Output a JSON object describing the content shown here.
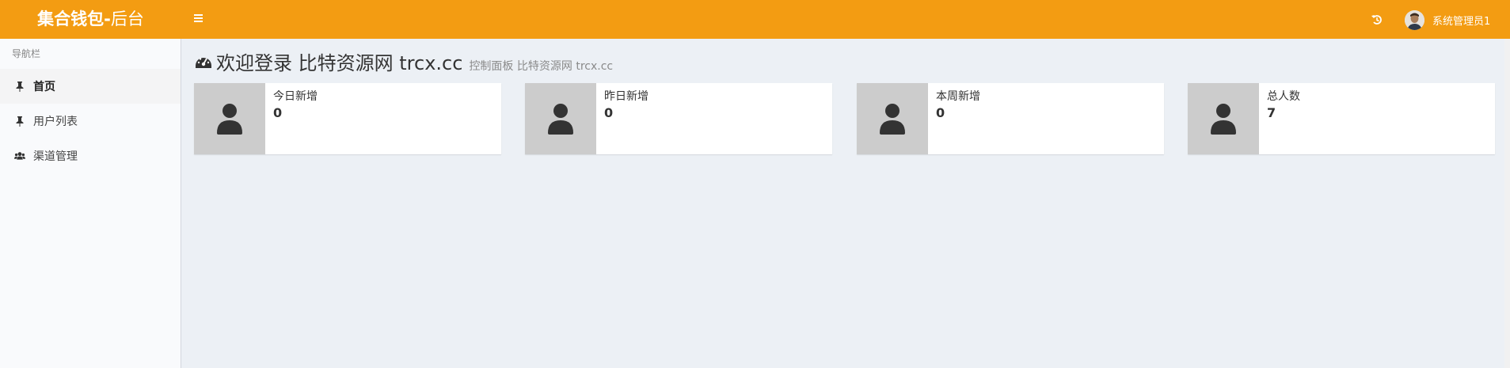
{
  "header": {
    "brand_bold": "集合钱包-",
    "brand_light": "后台",
    "user_name": "系统管理员1",
    "accent_color": "#f39c12"
  },
  "sidebar": {
    "heading": "导航栏",
    "items": [
      {
        "label": "首页",
        "icon": "pin-icon",
        "active": true
      },
      {
        "label": "用户列表",
        "icon": "pin-icon",
        "active": false
      },
      {
        "label": "渠道管理",
        "icon": "users-icon",
        "active": false
      }
    ]
  },
  "main": {
    "title": "欢迎登录 比特资源网 trcx.cc",
    "subtitle": "控制面板 比特资源网 trcx.cc",
    "stats": [
      {
        "label": "今日新增",
        "value": "0",
        "icon": "user-icon"
      },
      {
        "label": "昨日新增",
        "value": "0",
        "icon": "user-icon"
      },
      {
        "label": "本周新增",
        "value": "0",
        "icon": "user-icon"
      },
      {
        "label": "总人数",
        "value": "7",
        "icon": "user-icon"
      }
    ]
  }
}
